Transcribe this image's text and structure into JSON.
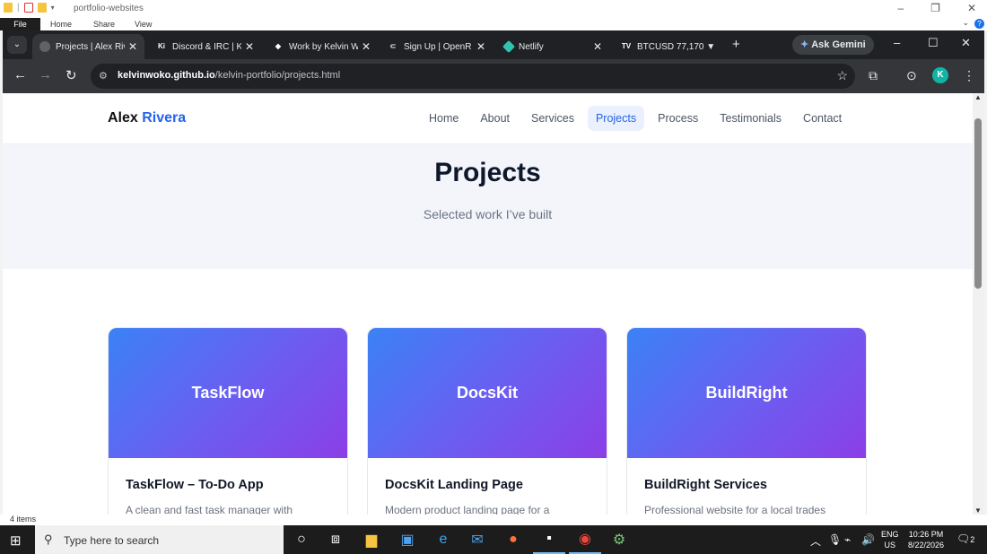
{
  "explorer": {
    "title": "portfolio-websites",
    "ribbon_tabs": [
      "File",
      "Home",
      "Share",
      "View"
    ],
    "status": "4 items"
  },
  "browser": {
    "tabs": [
      {
        "label": "Projects | Alex Riv",
        "favicon": "globe-icon",
        "active": true
      },
      {
        "label": "Discord & IRC | K",
        "favicon": "Ki"
      },
      {
        "label": "Work by Kelvin W",
        "favicon": "diamond-icon"
      },
      {
        "label": "Sign Up | OpenR",
        "favicon": "openrouter-icon"
      },
      {
        "label": "Netlify",
        "favicon": "netlify-icon"
      },
      {
        "label": "BTCUSD 77,170 ▼",
        "favicon": "TV"
      }
    ],
    "ask_gemini": "Ask Gemini",
    "url_domain": "kelvinwoko.github.io",
    "url_path": "/kelvin-portfolio/projects.html",
    "profile_initial": "K"
  },
  "site": {
    "brand_first": "Alex",
    "brand_last": "Rivera",
    "nav": [
      "Home",
      "About",
      "Services",
      "Projects",
      "Process",
      "Testimonials",
      "Contact"
    ],
    "active_nav": "Projects",
    "hero_title": "Projects",
    "hero_subtitle": "Selected work I’ve built",
    "projects": [
      {
        "cover": "TaskFlow",
        "title": "TaskFlow – To-Do App",
        "desc": "A clean and fast task manager with"
      },
      {
        "cover": "DocsKit",
        "title": "DocsKit Landing Page",
        "desc": "Modern product landing page for a"
      },
      {
        "cover": "BuildRight",
        "title": "BuildRight Services",
        "desc": "Professional website for a local trades"
      }
    ]
  },
  "taskbar": {
    "search_placeholder": "Type here to search",
    "lang_line1": "ENG",
    "lang_line2": "US",
    "time": "10:26 PM",
    "date": "8/22/2026",
    "notifications": "2"
  }
}
